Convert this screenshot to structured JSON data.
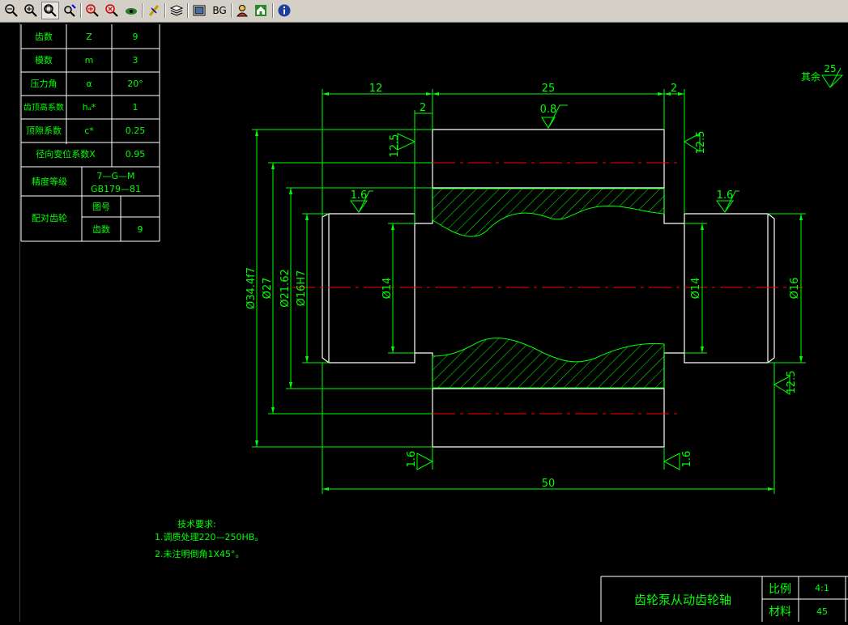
{
  "toolbar": {
    "buttons": [
      {
        "name": "zoom-out-icon",
        "glyph": "🔍"
      },
      {
        "name": "zoom-in-icon",
        "glyph": "🔍"
      },
      {
        "name": "zoom-window-icon",
        "glyph": "🔍"
      },
      {
        "name": "zoom-realtime-icon",
        "glyph": "✋"
      },
      {
        "name": "pan-icon",
        "glyph": "⊕"
      },
      {
        "name": "zoom-extents-icon",
        "glyph": "⊗"
      },
      {
        "name": "view-icon",
        "glyph": "👁"
      },
      {
        "name": "measure-icon",
        "glyph": "⚡"
      },
      {
        "name": "layers-icon",
        "glyph": "≋"
      },
      {
        "name": "background-icon",
        "glyph": "▣"
      },
      {
        "name": "bg-label",
        "glyph": "BG"
      },
      {
        "name": "user-icon",
        "glyph": "☺"
      },
      {
        "name": "home-icon",
        "glyph": "⌂"
      },
      {
        "name": "info-icon",
        "glyph": "ⓘ"
      }
    ]
  },
  "param_table": {
    "rows": [
      {
        "label": "齿数",
        "symbol": "Z",
        "value": "9"
      },
      {
        "label": "模数",
        "symbol": "m",
        "value": "3"
      },
      {
        "label": "压力角",
        "symbol": "α",
        "value": "20°"
      },
      {
        "label": "齿顶高系数",
        "symbol": "hₐ*",
        "value": "1"
      },
      {
        "label": "顶隙系数",
        "symbol": "c*",
        "value": "0.25"
      }
    ],
    "shift_label": "径向变位系数X",
    "shift_value": "0.95",
    "precision_label": "精度等级",
    "precision_value_1": "7—G—M",
    "precision_value_2": "GB179—81",
    "mating_label": "配对齿轮",
    "drawing_no_label": "图号",
    "teeth_label": "齿数",
    "teeth_value": "9"
  },
  "surface_note": {
    "label": "其余",
    "value": "25"
  },
  "dims": {
    "d12": "12",
    "d25": "25",
    "d2a": "2",
    "d2b": "2",
    "d50": "50",
    "r08": "0.8",
    "r16a": "1.6",
    "r16b": "1.6",
    "r16c": "1.6",
    "r16d": "1.6",
    "r125a": "12.5",
    "r125b": "12.5",
    "r125c": "12.5",
    "dia1": "Ø34.4f7",
    "dia2": "Ø27",
    "dia3": "Ø21.62",
    "dia4": "Ø16H7",
    "dia5": "Ø14",
    "dia6": "Ø14",
    "dia7": "Ø16"
  },
  "tech_req": {
    "title": "技术要求:",
    "line1": "1.调质处理220—250HB。",
    "line2": "2.未注明倒角1X45°。"
  },
  "title_block": {
    "part_name": "齿轮泵从动齿轮轴",
    "scale_label": "比例",
    "scale_value": "4:1",
    "material_label": "材料",
    "material_value": "45"
  },
  "colors": {
    "line": "#00ff00",
    "white": "#ffffff",
    "center": "#ff0000",
    "text": "#00ff00"
  }
}
